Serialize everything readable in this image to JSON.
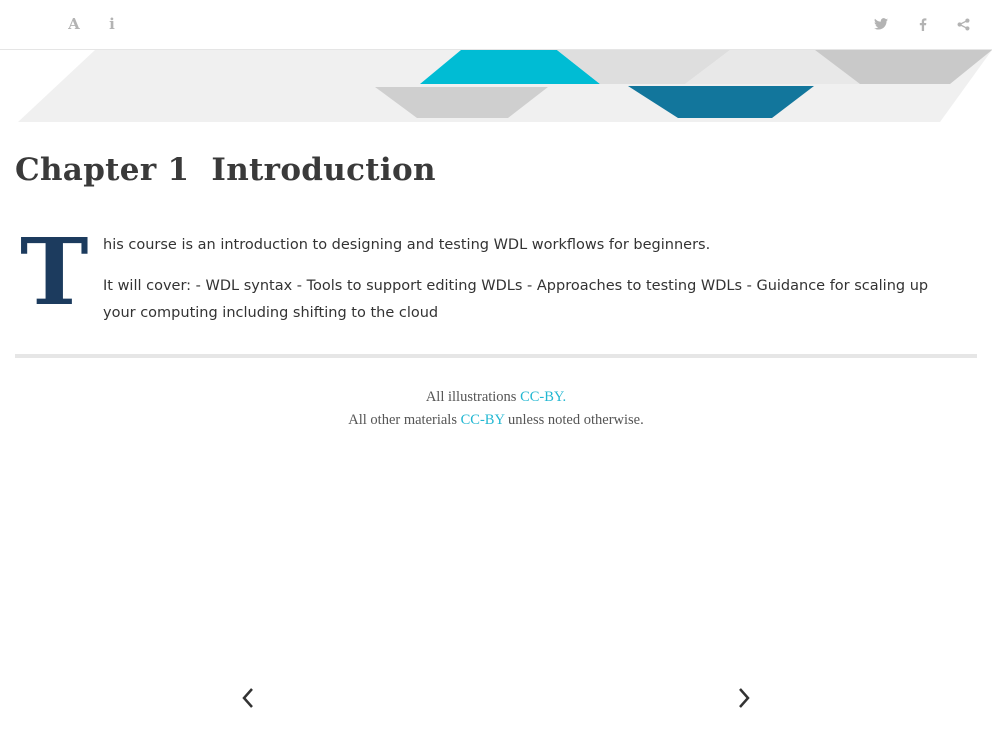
{
  "toolbar": {
    "font_settings_glyph": "A",
    "info_glyph": "i",
    "icons": [
      "font-settings-icon",
      "info-icon",
      "twitter-icon",
      "facebook-icon",
      "share-icon"
    ]
  },
  "chapter": {
    "number": "Chapter 1",
    "title": "Introduction"
  },
  "body": {
    "drop_cap": "T",
    "para1_rest": "his course is an introduction to designing and testing WDL workflows for beginners.",
    "para2": "It will cover: - WDL syntax - Tools to support editing WDLs - Approaches to testing WDLs - Guidance for scaling up your computing including shifting to the cloud"
  },
  "footer": {
    "line1_prefix": "All illustrations ",
    "line1_link": "CC-BY.",
    "line2_prefix": "All other materials ",
    "line2_link": "CC-BY",
    "line2_suffix": " unless noted otherwise."
  },
  "colors": {
    "accent_cyan": "#00bcd4",
    "accent_teal": "#12769c",
    "drop_cap": "#1c3b5e",
    "link": "#22b7d2"
  }
}
